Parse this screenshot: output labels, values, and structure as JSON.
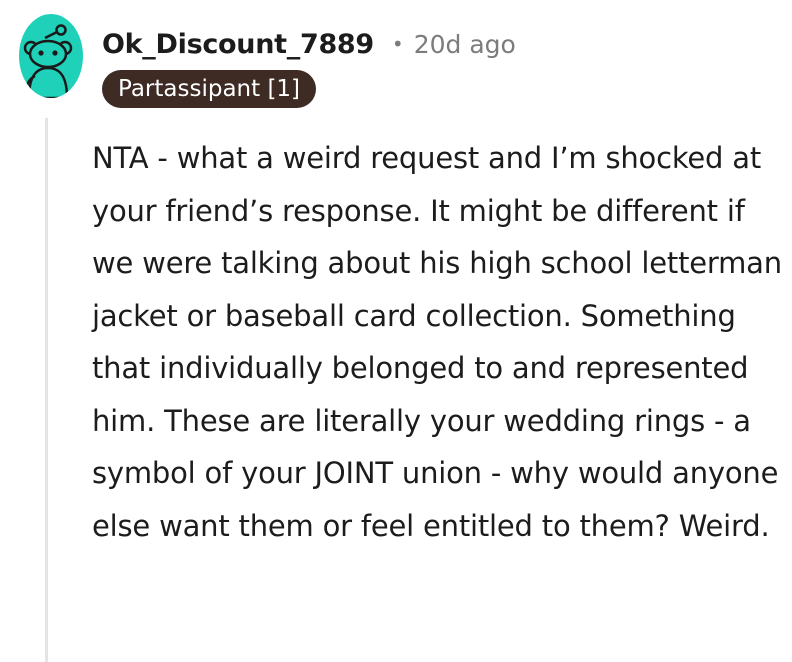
{
  "comment": {
    "username": "Ok_Discount_7889",
    "separator": "•",
    "timestamp": "20d ago",
    "flair": "Partassipant [1]",
    "body": "NTA - what a weird request and I’m shocked at your friend’s response. It might be different if we were talking about his high school letterman jacket or baseball card collection. Something that individually belonged to and represented him. These are literally your wedding rings - a symbol of your JOINT union - why would anyone else want them or feel entitled to them? Weird."
  },
  "avatar": {
    "icon": "snoo-avatar-icon",
    "background_color": "#1fd1b9"
  },
  "colors": {
    "flair_background": "#3d2b24",
    "flair_text": "#ffffff",
    "meta_text": "#7c7c7c",
    "thread_line": "#e4e4e4"
  }
}
